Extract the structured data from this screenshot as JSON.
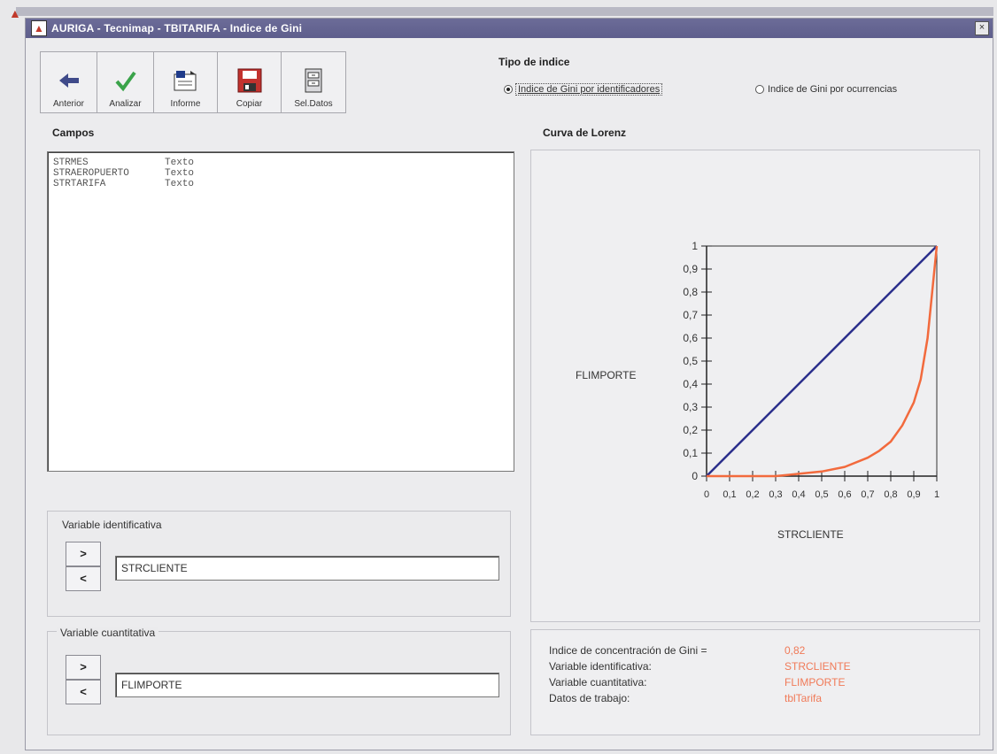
{
  "window": {
    "title": "AURIGA - Tecnimap - TBITARIFA - Indice de Gini",
    "close_label": "×"
  },
  "toolbar": {
    "buttons": [
      {
        "label": "Anterior",
        "icon": "back-arrow-icon"
      },
      {
        "label": "Analizar",
        "icon": "checkmark-icon"
      },
      {
        "label": "Informe",
        "icon": "report-icon"
      },
      {
        "label": "Copiar",
        "icon": "floppy-disk-icon"
      },
      {
        "label": "Sel.Datos",
        "icon": "data-cabinet-icon"
      }
    ]
  },
  "tipo_indice": {
    "title": "Tipo de indice",
    "options": [
      {
        "label": "Indice de Gini por identificadores",
        "selected": true
      },
      {
        "label": "Indice de Gini por ocurrencias",
        "selected": false
      }
    ]
  },
  "campos": {
    "title": "Campos",
    "rows": [
      {
        "name": "STRMES",
        "type": "Texto"
      },
      {
        "name": "STRAEROPUERTO",
        "type": "Texto"
      },
      {
        "name": "STRTARIFA",
        "type": "Texto"
      }
    ]
  },
  "variable_identificativa": {
    "label": "Variable identificativa",
    "value": "STRCLIENTE",
    "add_label": ">",
    "remove_label": "<"
  },
  "variable_cuantitativa": {
    "label": "Variable cuantitativa",
    "value": "FLIMPORTE",
    "add_label": ">",
    "remove_label": "<"
  },
  "lorenz": {
    "title": "Curva de Lorenz"
  },
  "stats": {
    "rows": [
      {
        "label": "Indice de concentración de Gini =",
        "value": "0,82"
      },
      {
        "label": "Variable identificativa:",
        "value": "STRCLIENTE"
      },
      {
        "label": "Variable cuantitativa:",
        "value": "FLIMPORTE"
      },
      {
        "label": "Datos de trabajo:",
        "value": "tblTarifa"
      }
    ]
  },
  "colors": {
    "titlebar": "#5e5e8c",
    "equality_line": "#2b2f8c",
    "lorenz_curve": "#f26a3d",
    "stat_value": "#f07a58"
  },
  "chart_data": {
    "type": "line",
    "xlabel": "STRCLIENTE",
    "ylabel": "FLIMPORTE",
    "xlim": [
      0,
      1
    ],
    "ylim": [
      0,
      1
    ],
    "x_ticks": [
      "0",
      "0,1",
      "0,2",
      "0,3",
      "0,4",
      "0,5",
      "0,6",
      "0,7",
      "0,8",
      "0,9",
      "1"
    ],
    "y_ticks": [
      "0",
      "0,1",
      "0,2",
      "0,3",
      "0,4",
      "0,5",
      "0,6",
      "0,7",
      "0,8",
      "0,9",
      "1"
    ],
    "series": [
      {
        "name": "",
        "color": "#2b2f8c",
        "x": [
          0,
          1
        ],
        "y": [
          0,
          1
        ]
      },
      {
        "name": "",
        "color": "#f26a3d",
        "x": [
          0,
          0.3,
          0.4,
          0.5,
          0.6,
          0.7,
          0.75,
          0.8,
          0.85,
          0.9,
          0.93,
          0.96,
          0.98,
          1
        ],
        "y": [
          0,
          0,
          0.01,
          0.02,
          0.04,
          0.08,
          0.11,
          0.15,
          0.22,
          0.32,
          0.42,
          0.6,
          0.8,
          1
        ]
      }
    ]
  }
}
